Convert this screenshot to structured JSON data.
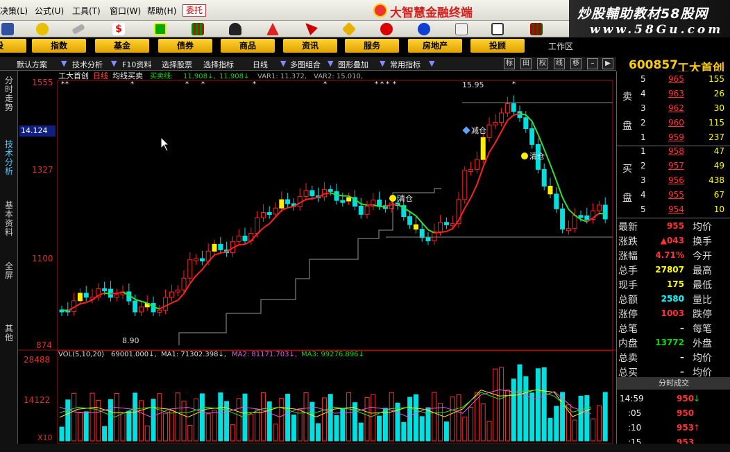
{
  "menu": [
    "决策(L)",
    "公式(U)",
    "工具(T)",
    "窗口(W)",
    "帮助(H)"
  ],
  "entrust_label": "委托",
  "brand_title": "大智慧金融终端",
  "watermark": {
    "line1": "炒股輔助教材58股网",
    "line2": "www.58Gu.com"
  },
  "nav_tabs": [
    "股",
    "指数",
    "基金",
    "债券",
    "商品",
    "资讯",
    "服务",
    "房地产",
    "投顾"
  ],
  "workarea_label": "工作区",
  "toolbar": {
    "items": [
      "默认方案",
      "技术分析",
      "F10资料",
      "选择股票",
      "选择指标",
      "日线",
      "多图组合",
      "图形叠加",
      "常用指标"
    ],
    "buttons": [
      "标",
      "田",
      "权",
      "线",
      "移"
    ]
  },
  "side_tabs": [
    "分时走势",
    "技术分析",
    "基本资料",
    "全屏",
    "其他"
  ],
  "stock": {
    "code": "600857",
    "name": "工大首创"
  },
  "main_header": {
    "name": "工大首创",
    "period": "日线",
    "indicator": "均线买卖",
    "label_buy": "买卖线:",
    "v1": "11.908↓,",
    "v2": "11.908↓",
    "var1": "VAR1: 11.372,",
    "var2": "VAR2: 15.010,"
  },
  "price_axis": [
    "1555",
    "1327",
    "1100",
    "874"
  ],
  "crosshair_price": "14.124",
  "annotations": {
    "high": "15.95",
    "low": "8.90",
    "clear1": "清仓",
    "clear2": "清仓",
    "reduce": "减仓"
  },
  "vol_header": {
    "label": "VOL(5,10,20)",
    "vol": "69001.000↓,",
    "ma1": "MA1: 71302.398↓,",
    "ma2": "MA2: 81171.703↓,",
    "ma3": "MA3: 99276.896↓"
  },
  "vol_axis": [
    "28488",
    "14122",
    "X10"
  ],
  "quote": {
    "sell_label": [
      "卖",
      "盘"
    ],
    "buy_label": [
      "买",
      "盘"
    ],
    "sell": [
      {
        "lvl": "5",
        "price": "965",
        "vol": "155"
      },
      {
        "lvl": "4",
        "price": "963",
        "vol": "26"
      },
      {
        "lvl": "3",
        "price": "962",
        "vol": "30"
      },
      {
        "lvl": "2",
        "price": "960",
        "vol": "115"
      },
      {
        "lvl": "1",
        "price": "959",
        "vol": "237"
      }
    ],
    "buy": [
      {
        "lvl": "1",
        "price": "958",
        "vol": "47"
      },
      {
        "lvl": "2",
        "price": "957",
        "vol": "49"
      },
      {
        "lvl": "3",
        "price": "956",
        "vol": "438"
      },
      {
        "lvl": "4",
        "price": "955",
        "vol": "67"
      },
      {
        "lvl": "5",
        "price": "954",
        "vol": "10"
      }
    ],
    "stats": [
      {
        "l": "最新",
        "v": "955",
        "r": "均价",
        "c": "red"
      },
      {
        "l": "涨跌",
        "v": "▲043",
        "r": "换手",
        "c": "red"
      },
      {
        "l": "涨幅",
        "v": "4.71%",
        "r": "今开",
        "c": "red"
      },
      {
        "l": "总手",
        "v": "27807",
        "r": "最高",
        "c": "yel"
      },
      {
        "l": "现手",
        "v": "175",
        "r": "最低",
        "c": "yel"
      },
      {
        "l": "总额",
        "v": "2580",
        "r": "量比",
        "c": "cya"
      },
      {
        "l": "涨停",
        "v": "1003",
        "r": "跌停",
        "c": "red"
      },
      {
        "l": "总笔",
        "v": "–",
        "r": "每笔",
        "c": "wht"
      },
      {
        "l": "内盘",
        "v": "13772",
        "r": "外盘",
        "c": "grn"
      },
      {
        "l": "总卖",
        "v": "–",
        "r": "均价",
        "c": "wht"
      },
      {
        "l": "总买",
        "v": "–",
        "r": "均价",
        "c": "wht"
      }
    ],
    "ticks_title": "分时成交",
    "ticks": [
      {
        "t": "14:59",
        "p": "950",
        "a": "↓"
      },
      {
        "t": ":05",
        "p": "950",
        "a": ""
      },
      {
        "t": ":10",
        "p": "953",
        "a": "↑"
      },
      {
        "t": ":15",
        "p": "953",
        "a": ""
      }
    ]
  }
}
